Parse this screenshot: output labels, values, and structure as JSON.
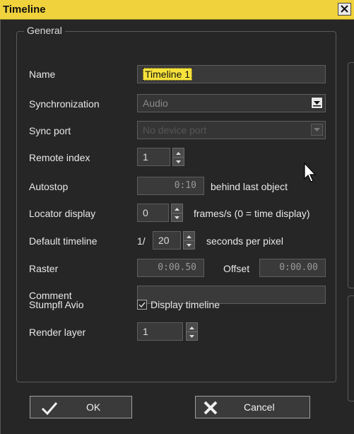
{
  "window": {
    "title": "Timeline"
  },
  "group": {
    "legend": "General"
  },
  "fields": {
    "name": {
      "label": "Name",
      "value": "Timeline 1"
    },
    "sync": {
      "label": "Synchronization",
      "value": "Audio"
    },
    "syncport": {
      "label": "Sync port",
      "value": "No device port"
    },
    "remote": {
      "label": "Remote index",
      "value": "1"
    },
    "autostop": {
      "label": "Autostop",
      "value": "0:10",
      "suffix": "behind last object"
    },
    "locator": {
      "label": "Locator display",
      "value": "0",
      "suffix": "frames/s (0 = time display)"
    },
    "deftimeline": {
      "label": "Default timeline",
      "prefix": "1/",
      "value": "20",
      "suffix": "seconds per pixel"
    },
    "raster": {
      "label": "Raster",
      "value": "0:00.50",
      "offset_label": "Offset",
      "offset_value": "0:00.00"
    },
    "comment": {
      "label": "Comment",
      "value": ""
    },
    "avio": {
      "label": "Stumpfl Avio",
      "checkbox_label": "Display timeline",
      "checked": true
    },
    "render": {
      "label": "Render layer",
      "value": "1"
    }
  },
  "buttons": {
    "ok": "OK",
    "cancel": "Cancel"
  },
  "colors": {
    "titlebar": "#f0d23c",
    "background": "#262626",
    "selection": "#f7e23b"
  }
}
